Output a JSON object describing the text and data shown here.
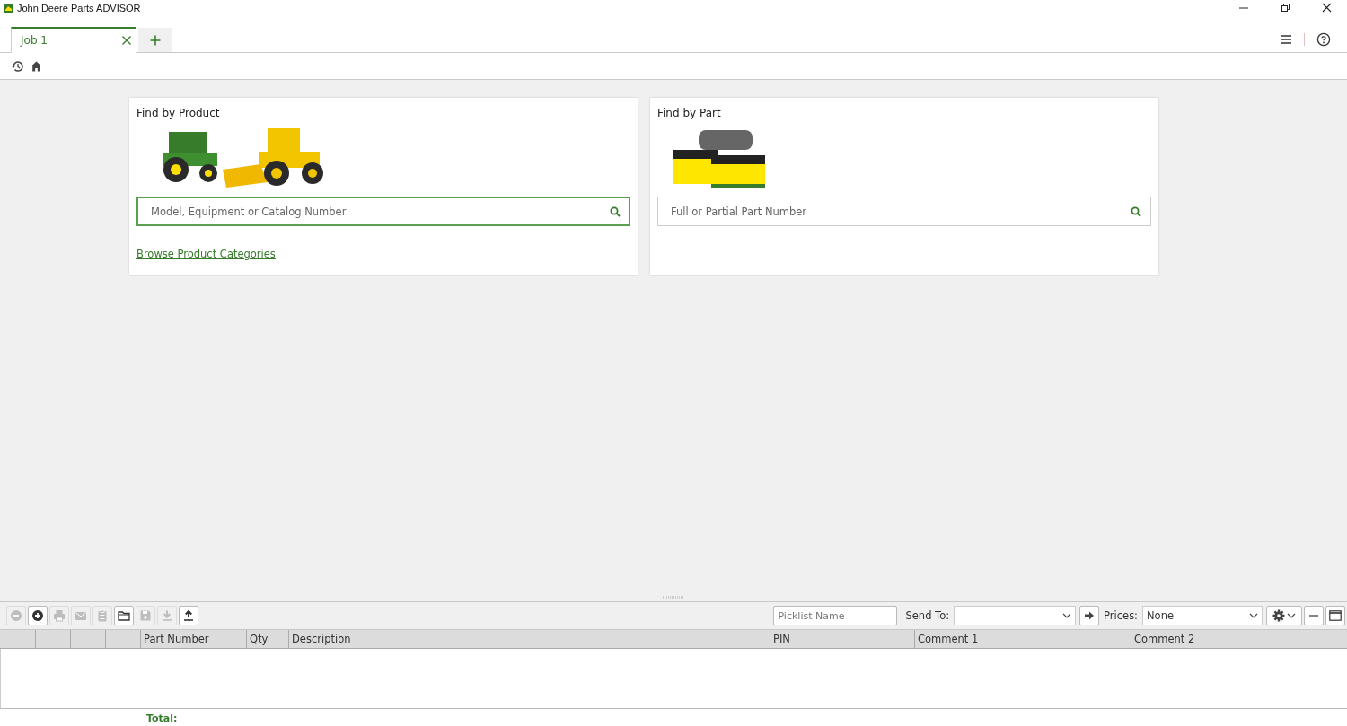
{
  "window": {
    "title": "John Deere Parts ADVISOR"
  },
  "tabs": [
    {
      "label": "Job 1",
      "selected": true
    }
  ],
  "cards": [
    {
      "title": "Find by Product",
      "kind": "vehicles",
      "search": {
        "placeholder": "Model, Equipment or Catalog Number",
        "focused": true
      },
      "link": "Browse Product Categories"
    },
    {
      "title": "Find by Part",
      "kind": "parts",
      "search": {
        "placeholder": "Full or Partial Part Number",
        "focused": false
      }
    }
  ],
  "picklist": {
    "toolbar": [
      {
        "kind": "remove",
        "disabled": true
      },
      {
        "kind": "add",
        "disabled": false
      },
      {
        "kind": "print",
        "disabled": true
      },
      {
        "kind": "email",
        "disabled": true
      },
      {
        "kind": "clipboard",
        "disabled": true
      },
      {
        "kind": "open",
        "disabled": false
      },
      {
        "kind": "save",
        "disabled": true
      },
      {
        "kind": "download",
        "disabled": true
      },
      {
        "kind": "upload",
        "disabled": false
      }
    ],
    "name_field": {
      "placeholder": "Picklist Name"
    },
    "send_to_label": "Send To:",
    "prices_label": "Prices:",
    "prices_value": "None",
    "columns": [
      "",
      "",
      "",
      "",
      "Part Number",
      "Qty",
      "Description",
      "PIN",
      "Comment 1",
      "Comment 2"
    ],
    "total_label": "Total:"
  }
}
